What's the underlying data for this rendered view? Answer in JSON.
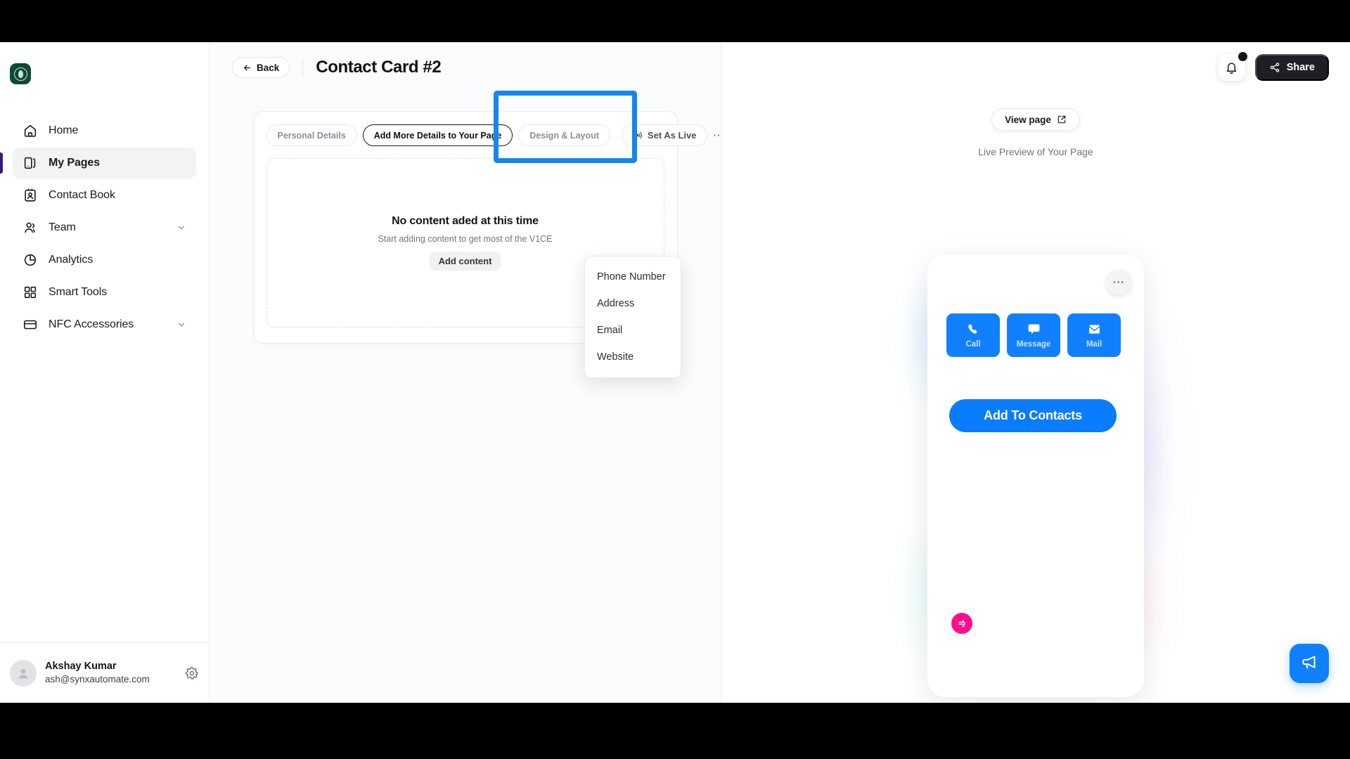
{
  "sidebar": {
    "brand_icon": "starbucks-logo-icon",
    "items": [
      {
        "label": "Home",
        "icon": "home-icon",
        "active": false,
        "expandable": false
      },
      {
        "label": "My Pages",
        "icon": "pages-icon",
        "active": true,
        "expandable": false
      },
      {
        "label": "Contact Book",
        "icon": "contact-book-icon",
        "active": false,
        "expandable": false
      },
      {
        "label": "Team",
        "icon": "team-icon",
        "active": false,
        "expandable": true
      },
      {
        "label": "Analytics",
        "icon": "analytics-pie-icon",
        "active": false,
        "expandable": false
      },
      {
        "label": "Smart Tools",
        "icon": "grid-icon",
        "active": false,
        "expandable": false
      },
      {
        "label": "NFC Accessories",
        "icon": "card-icon",
        "active": false,
        "expandable": true
      }
    ],
    "user": {
      "name": "Akshay Kumar",
      "email": "ash@synxautomate.com",
      "avatar_icon": "user-avatar-icon",
      "settings_icon": "gear-icon"
    }
  },
  "header": {
    "back_label": "Back",
    "back_icon": "arrow-left-icon",
    "title": "Contact Card #2"
  },
  "topright": {
    "bell_icon": "bell-icon",
    "has_notification": true,
    "share_label": "Share",
    "share_icon": "share-nodes-icon"
  },
  "editor": {
    "tabs": [
      {
        "label": "Personal Details",
        "selected": false
      },
      {
        "label": "Add More Details to Your Page",
        "selected": true,
        "highlighted": true
      },
      {
        "label": "Design & Layout",
        "selected": false
      }
    ],
    "set_as_live_label": "Set As Live",
    "set_as_live_icon": "broadcast-icon",
    "overflow_icon": "ellipsis-icon",
    "empty_state": {
      "title": "No content aded at this time",
      "subtitle": "Start adding content to get most of the V1CE",
      "button_label": "Add content"
    },
    "dropdown": {
      "open": true,
      "options": [
        "Phone Number",
        "Address",
        "Email",
        "Website"
      ]
    }
  },
  "preview": {
    "view_page_label": "View page",
    "view_page_icon": "external-link-icon",
    "caption": "Live Preview of Your Page",
    "phone": {
      "overflow_icon": "ellipsis-icon",
      "actions": [
        {
          "label": "Call",
          "icon": "phone-icon"
        },
        {
          "label": "Message",
          "icon": "message-icon"
        },
        {
          "label": "Mail",
          "icon": "mail-icon"
        }
      ],
      "add_to_contacts_label": "Add To Contacts",
      "badge_icon": "v1ce-logo-icon"
    }
  },
  "chat_widget": {
    "icon": "megaphone-icon"
  },
  "colors": {
    "accent_blue": "#1180ff",
    "highlight_blue": "#1485f2",
    "dark": "#1d1f25",
    "brand_green": "#0b4a34",
    "badge_pink": "#ff0f8e",
    "sidebar_active_bar": "#3b1a78"
  }
}
